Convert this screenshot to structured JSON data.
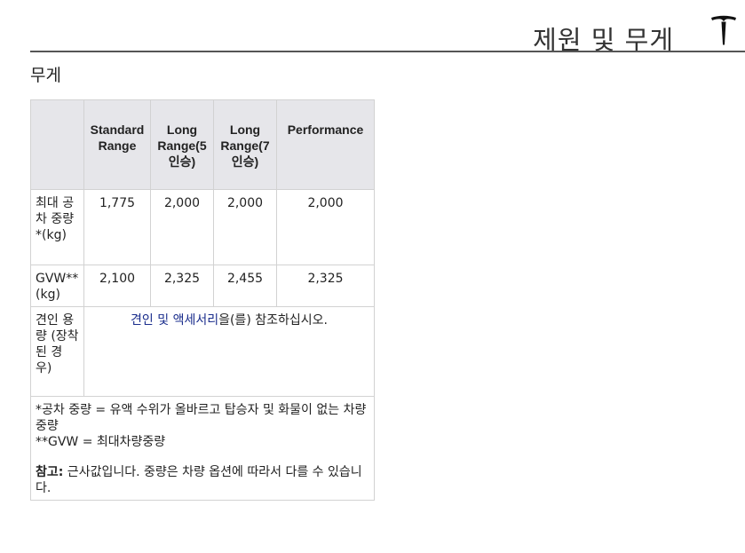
{
  "header": {
    "title": "제원 및 무게",
    "logo": "tesla-logo-icon"
  },
  "section": {
    "title": "무게"
  },
  "table": {
    "columns": [
      "Standard Range",
      "Long Range(5 인승)",
      "Long Range(7 인승)",
      "Performance"
    ],
    "rows": [
      {
        "label": "최대 공차 중량 *(kg)",
        "values": [
          "1,775",
          "2,000",
          "2,000",
          "2,000"
        ]
      },
      {
        "label": "GVW** (kg)",
        "values": [
          "2,100",
          "2,325",
          "2,455",
          "2,325"
        ]
      }
    ],
    "towing": {
      "label": "견인 용량 (장착 된 경 우)",
      "link_text": "견인 및 액세서리",
      "suffix": "을(를) 참조하십시오."
    },
    "notes": {
      "curb_weight": "*공차 중량 = 유액 수위가 올바르고 탑승자 및 화물이 없는 차량 중량",
      "gvw": "**GVW = 최대차량중량",
      "note_label": "참고:",
      "note_text": " 근사값입니다. 중량은 차량 옵션에 따라서 다를 수 있습니다."
    }
  }
}
